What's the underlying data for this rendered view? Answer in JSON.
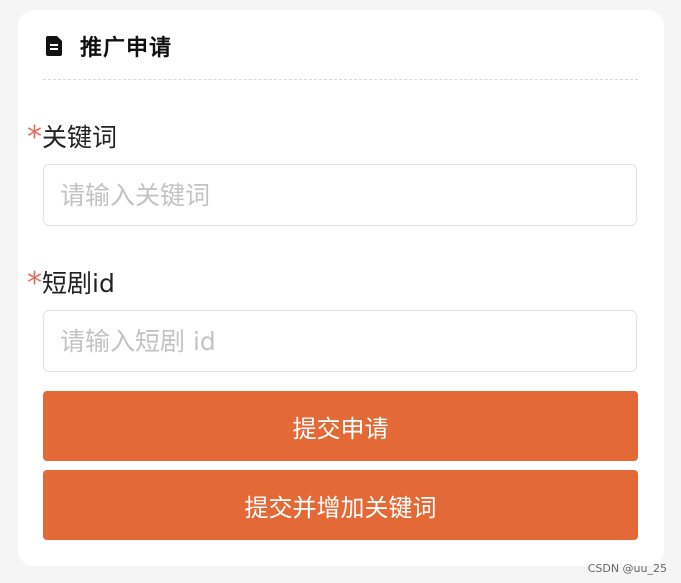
{
  "header": {
    "icon": "document-icon",
    "title": "推广申请"
  },
  "form": {
    "keyword": {
      "required_mark": "*",
      "label": "关键词",
      "value": "",
      "placeholder": "请输入关键词"
    },
    "drama_id": {
      "required_mark": "*",
      "label": "短剧id",
      "value": "",
      "placeholder": "请输入短剧 id"
    }
  },
  "buttons": {
    "submit": "提交申请",
    "submit_add_keyword": "提交并增加关键词"
  },
  "watermark": "CSDN @uu_25",
  "colors": {
    "accent": "#e36a36",
    "required": "#e06c60",
    "placeholder": "#c3c3c3"
  }
}
